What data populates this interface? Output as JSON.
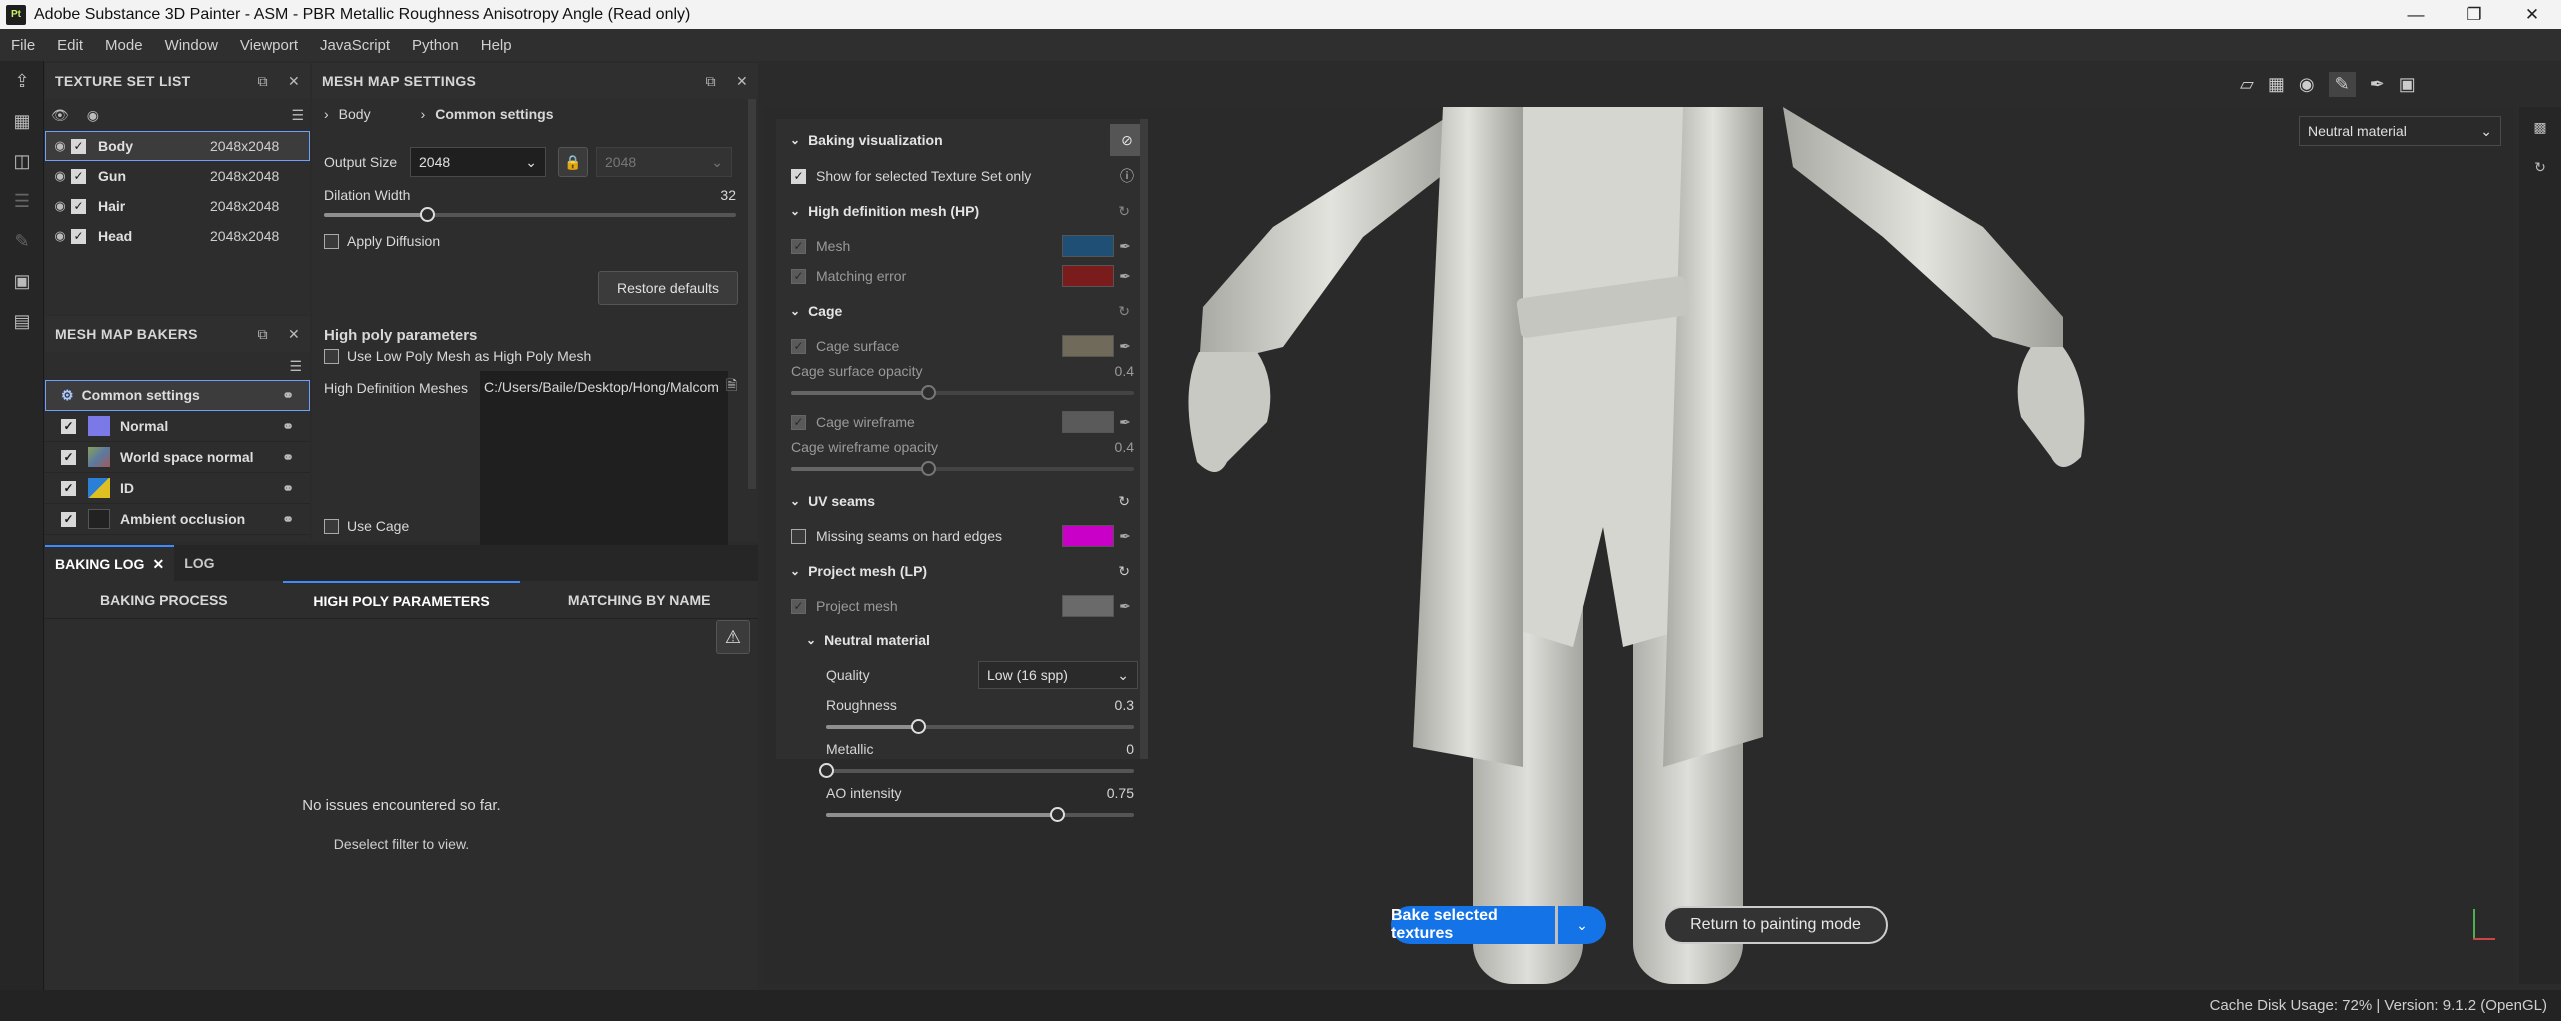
{
  "window": {
    "title": "Adobe Substance 3D Painter - ASM - PBR Metallic Roughness Anisotropy Angle (Read only)",
    "logo": "Pt"
  },
  "menu": [
    "File",
    "Edit",
    "Mode",
    "Window",
    "Viewport",
    "JavaScript",
    "Python",
    "Help"
  ],
  "texture_set_list": {
    "title": "TEXTURE SET LIST",
    "items": [
      {
        "name": "Body",
        "res": "2048x2048"
      },
      {
        "name": "Gun",
        "res": "2048x2048"
      },
      {
        "name": "Hair",
        "res": "2048x2048"
      },
      {
        "name": "Head",
        "res": "2048x2048"
      }
    ]
  },
  "mesh_map_bakers": {
    "title": "MESH MAP BAKERS",
    "items": [
      {
        "name": "Common settings",
        "color": "#3a3a3a"
      },
      {
        "name": "Normal",
        "color": "#7b78e8"
      },
      {
        "name": "World space normal",
        "color": "#8aa05a"
      },
      {
        "name": "ID",
        "color": "#2c7fd6"
      },
      {
        "name": "Ambient occlusion",
        "color": "#222222"
      }
    ]
  },
  "mesh_map_settings": {
    "title": "MESH MAP SETTINGS",
    "crumb1": "Body",
    "crumb2": "Common settings",
    "output_size_label": "Output Size",
    "output_size": "2048",
    "output_size_locked": "2048",
    "dilation_label": "Dilation Width",
    "dilation_value": "32",
    "apply_diffusion": "Apply Diffusion",
    "restore": "Restore defaults",
    "high_poly_title": "High poly parameters",
    "use_low_poly": "Use Low Poly Mesh as High Poly Mesh",
    "hd_meshes_label": "High Definition Meshes",
    "hd_meshes_value": "C:/Users/Baile/Desktop/Hong/Malcom",
    "use_cage": "Use Cage"
  },
  "log": {
    "tabs": [
      "BAKING LOG",
      "LOG"
    ],
    "subtabs": [
      "BAKING PROCESS",
      "HIGH POLY PARAMETERS",
      "MATCHING BY NAME"
    ],
    "message": "No issues encountered so far.",
    "hint": "Deselect filter to view."
  },
  "baking_vis": {
    "title": "Baking visualization",
    "show_selected": "Show for selected Texture Set only",
    "hp_title": "High definition mesh (HP)",
    "mesh": "Mesh",
    "matching_error": "Matching error",
    "cage_title": "Cage",
    "cage_surface": "Cage surface",
    "cage_surface_opacity": "Cage surface opacity",
    "cage_surface_opacity_val": "0.4",
    "cage_wireframe": "Cage wireframe",
    "cage_wireframe_opacity": "Cage wireframe opacity",
    "cage_wireframe_opacity_val": "0.4",
    "uv_title": "UV seams",
    "missing_seams": "Missing seams on hard edges",
    "project_title": "Project mesh (LP)",
    "project_mesh": "Project mesh",
    "neutral_title": "Neutral material",
    "quality_label": "Quality",
    "quality_value": "Low (16 spp)",
    "roughness_label": "Roughness",
    "roughness_val": "0.3",
    "metallic_label": "Metallic",
    "metallic_val": "0",
    "ao_label": "AO intensity",
    "ao_val": "0.75",
    "colors": {
      "mesh": "#1f4f75",
      "matching": "#7a1c1c",
      "cage_surface": "#6f6a5a",
      "cage_wire": "#5a5a5a",
      "uv": "#c800c8",
      "project": "#6a6a6a"
    },
    "roughness_frac": 0.3,
    "metallic_frac": 0,
    "ao_frac": 0.75,
    "cage_surface_frac": 0.4,
    "cage_wire_frac": 0.4,
    "dilation_frac": 0.25
  },
  "viewport": {
    "material": "Neutral material",
    "bake_button": "Bake selected textures",
    "return_button": "Return to painting mode"
  },
  "status": {
    "text": "Cache Disk Usage:  72% | Version: 9.1.2 (OpenGL)"
  }
}
